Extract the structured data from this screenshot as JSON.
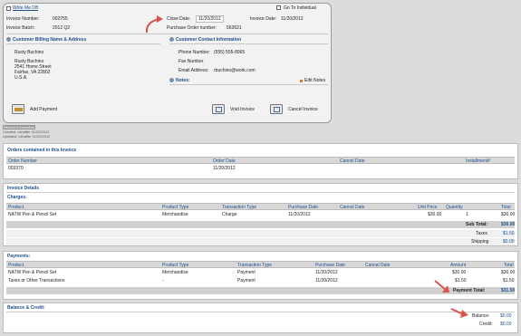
{
  "top": {
    "write_me_off": "Write Me Off",
    "go_to_individual": "Go To Individual",
    "invoice_number_label": "Invoice Number:",
    "invoice_number": "002755",
    "invoice_batch_label": "Invoice Batch:",
    "invoice_batch": "2012 Q2",
    "close_date_label": "Close Date:",
    "close_date": "11/20/2012",
    "invoice_date_label": "Invoice Date:",
    "invoice_date": "11/20/2012",
    "po_label": "Purchase Order number:",
    "po_number": "563621"
  },
  "billing": {
    "title": "Customer Billing Name & Address",
    "name": "Rusty Buchino",
    "line1": "Rusty Buchino",
    "line2": "2541 Home Street",
    "line3": "Fairfax, VA 22802",
    "line4": "U.S.A."
  },
  "contact": {
    "title": "Customer Contact Information",
    "phone_label": "Phone Number:",
    "phone": "(555) 555-8965",
    "fax_label": "Fax Number",
    "email_label": "Email Address:",
    "email": "rbuchino@work.com",
    "notes_label": "Notes:",
    "edit_notes": "Edit Notes"
  },
  "actions": {
    "add_payment": "Add Payment",
    "void_invoice": "Void Invoice",
    "cancel_invoice": "Cancel Invoice"
  },
  "meta": {
    "record_info": "Record Information",
    "created": "Created: cshaffer 11/20/2012",
    "updated": "Updated: cshaffer 11/20/2012"
  },
  "orders": {
    "title": "Orders contained in this Invoice",
    "headers": [
      "Order Number",
      "Order Date",
      "Cancel Date",
      "Installment#"
    ],
    "rows": [
      [
        "003370",
        "11/20/2012",
        "",
        ""
      ]
    ]
  },
  "invoice_details": {
    "title": "Invoice Details",
    "charges_title": "Charges:",
    "headers": [
      "Product",
      "Product Type",
      "Transaction Type",
      "Purchase Date",
      "Cancel Date",
      "Unit Price",
      "Quantity",
      "Total"
    ],
    "rows": [
      [
        "NATW Pen & Pencil Set",
        "Merchandise",
        "Charge",
        "11/20/2012",
        "",
        "$30.00",
        "1",
        "$30.00"
      ]
    ],
    "subtotal_label": "Sub Total:",
    "subtotal": "$30.00",
    "taxes_label": "Taxes",
    "taxes": "$1.50",
    "shipping_label": "Shipping",
    "shipping": "$0.00"
  },
  "payments": {
    "title": "Payments:",
    "headers": [
      "Product",
      "Product Type",
      "Transaction Type",
      "Purchase Date",
      "Cancel Date",
      "Amount",
      "Total"
    ],
    "rows": [
      [
        "NATW Pen & Pencil Set",
        "Merchandise",
        "Payment",
        "11/20/2012",
        "",
        "$30.00",
        "$30.00"
      ],
      [
        "Taxes or Other Transactions",
        "-",
        "Payment",
        "11/20/2012",
        "",
        "$1.50",
        "$1.50"
      ]
    ],
    "total_label": "Payment Total:",
    "total": "$31.50"
  },
  "balance": {
    "title": "Balance & Credit:",
    "balance_label": "Balance:",
    "balance": "$0.00",
    "credit_label": "Credit:",
    "credit": "$0.00"
  },
  "colors": {
    "link": "#1f4e8f",
    "arrow": "#d9534f"
  }
}
